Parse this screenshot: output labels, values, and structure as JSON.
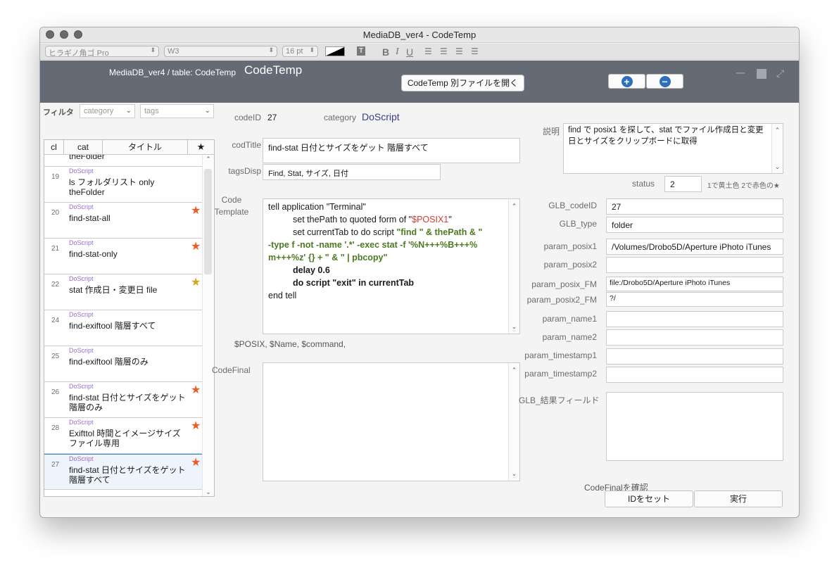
{
  "window": {
    "title": "MediaDB_ver4 - CodeTemp"
  },
  "format_bar": {
    "font": "ヒラギノ角ゴ Pro",
    "weight": "W3",
    "size": "16 pt",
    "bold": "B",
    "italic": "I",
    "underline": "U",
    "text_style": "T"
  },
  "header": {
    "table_label": "MediaDB_ver4 / table: CodeTemp",
    "layout_title": "CodeTemp",
    "open_file_button": "CodeTemp 別ファイルを開く"
  },
  "filter": {
    "label": "フィルタ",
    "category_placeholder": "category",
    "tags_placeholder": "tags"
  },
  "list": {
    "columns": [
      "cl",
      "cat",
      "タイトル",
      "★"
    ],
    "partial_row": {
      "title": "ls フォルダリスト all Below theFolder"
    },
    "rows": [
      {
        "id": "19",
        "cat": "DoScript",
        "title": "ls フォルダリスト only theFolder",
        "star": "",
        "star_color": ""
      },
      {
        "id": "20",
        "cat": "DoScript",
        "title": "find-stat-all",
        "star": "★",
        "star_color": "#f05a28"
      },
      {
        "id": "21",
        "cat": "DoScript",
        "title": "find-stat-only",
        "star": "★",
        "star_color": "#f05a28"
      },
      {
        "id": "22",
        "cat": "DoScript",
        "title": "stat 作成日・変更日 file",
        "star": "★",
        "star_color": "#d9a520"
      },
      {
        "id": "24",
        "cat": "DoScript",
        "title": "find-exiftool 階層すべて",
        "star": "",
        "star_color": ""
      },
      {
        "id": "25",
        "cat": "DoScript",
        "title": "find-exiftool 階層のみ",
        "star": "",
        "star_color": ""
      },
      {
        "id": "26",
        "cat": "DoScript",
        "title": "find-stat 日付とサイズをゲット 階層のみ",
        "star": "★",
        "star_color": "#f05a28"
      },
      {
        "id": "28",
        "cat": "DoScript",
        "title": "Exifttol 時間とイメージサイズ ファイル専用",
        "star": "★",
        "star_color": "#f05a28"
      },
      {
        "id": "27",
        "cat": "DoScript",
        "title": "find-stat 日付とサイズをゲット 階層すべて",
        "star": "★",
        "star_color": "#f05a28"
      }
    ]
  },
  "record": {
    "codeID_label": "codeID",
    "codeID": "27",
    "category_label": "category",
    "category": "DoScript",
    "codTitle_label": "codTitle",
    "codTitle": "find-stat 日付とサイズをゲット 階層すべて",
    "tagsDisp_label": "tagsDisp",
    "tagsDisp": "Find, Stat, サイズ, 日付",
    "codeTemplate_label_1": "Code",
    "codeTemplate_label_2": "Template",
    "code": {
      "l1": "tell application \"Terminal\"",
      "l2a": "set thePath to quoted form of \"",
      "l2b": "$POSIX1",
      "l2c": "\"",
      "l3a": "set currentTab to do script ",
      "l3b": "\"find \" & thePath & \"",
      "l4": "-type f -not -name '.*' -exec stat -f '%N+++%B+++%",
      "l5": "m+++%z' {} + \" & \" | pbcopy\"",
      "l6": "delay 0.6",
      "l7": "do script \"exit\" in currentTab",
      "l8": "end tell"
    },
    "vars_hint": "$POSIX, $Name, $command,",
    "codeFinal_label": "CodeFinal",
    "codeFinal": "",
    "description_label": "説明",
    "description": "find で posix1 を探して、stat でファイル作成日と変更日とサイズをクリップボードに取得",
    "status_label": "status",
    "status": "2",
    "status_hint": "1で黄土色 2で赤色の★"
  },
  "params": {
    "glb_codeID_label": "GLB_codeID",
    "glb_codeID": "27",
    "glb_type_label": "GLB_type",
    "glb_type": "folder",
    "param_posix1_label": "param_posix1",
    "param_posix1": "/Volumes/Drobo5D/Aperture iPhoto iTunes",
    "param_posix2_label": "param_posix2",
    "param_posix2": "",
    "param_posix_fm_label": "param_posix_FM",
    "param_posix_fm": "file:/Drobo5D/Aperture iPhoto iTunes",
    "param_posix2_fm_label": "param_posix2_FM",
    "param_posix2_fm": "?/",
    "param_name1_label": "param_name1",
    "param_name1": "",
    "param_name2_label": "param_name2",
    "param_name2": "",
    "param_timestamp1_label": "param_timestamp1",
    "param_timestamp1": "",
    "param_timestamp2_label": "param_timestamp2",
    "param_timestamp2": "",
    "glb_result_label": "GLB_結果フィールド",
    "glb_result": ""
  },
  "footer": {
    "confirm_label": "CodeFinalを確認",
    "set_id_button": "IDをセット",
    "run_button": "実行"
  }
}
